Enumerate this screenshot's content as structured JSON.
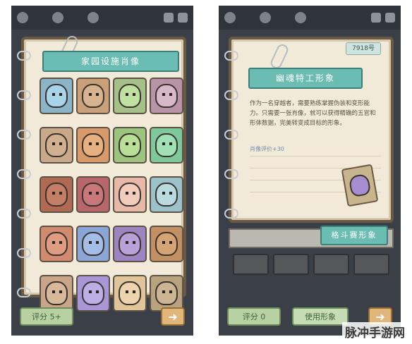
{
  "left": {
    "banner_title": "家园设施肖像",
    "button_label": "评分 5+",
    "arrow_label": "➜",
    "portraits": [
      {
        "color": "#8cb4c9",
        "face": "#a9d3e6"
      },
      {
        "color": "#c9a07a",
        "face": "#d7b48f"
      },
      {
        "color": "#a6c08a",
        "face": "#bfe0a0"
      },
      {
        "color": "#b993a8",
        "face": "#d6b8c8"
      },
      {
        "color": "#c9a98a",
        "face": "#d1b090"
      },
      {
        "color": "#d89a6a",
        "face": "#e6b080"
      },
      {
        "color": "#9bc57e",
        "face": "#b8de98"
      },
      {
        "color": "#7ec99b",
        "face": "#9fe0b4"
      },
      {
        "color": "#b06a54",
        "face": "#c47e66"
      },
      {
        "color": "#b8666a",
        "face": "#c8787a"
      },
      {
        "color": "#e7b8a8",
        "face": "#f2cbbd"
      },
      {
        "color": "#9bc2c8",
        "face": "#b9dadf"
      },
      {
        "color": "#d08a6e",
        "face": "#de9c82"
      },
      {
        "color": "#8aa6d6",
        "face": "#a4bde6"
      },
      {
        "color": "#9b86c2",
        "face": "#b6a2d8"
      },
      {
        "color": "#c29062",
        "face": "#d4a474"
      },
      {
        "color": "#c9a68a",
        "face": "#d8b89a"
      },
      {
        "color": "#a896d6",
        "face": "#bdaee6"
      },
      {
        "color": "#e0c49a",
        "face": "#eed4ae"
      },
      {
        "color": "#b9a27e",
        "face": "#cbb592"
      }
    ]
  },
  "right": {
    "tab_label": "7918号",
    "banner_title": "幽魂特工形象",
    "description": "作为一名穿越者，需要熟练掌握伪装和变形能力。只需要一张肖像，就可以获得精确的五官和形体数据，完美转变成目标的形象。",
    "rating": "肖像评价+30",
    "style_banner": "格斗赛形象",
    "btn_score": "评分 0",
    "btn_use": "使用形象",
    "arrow_label": "➜"
  },
  "watermark": "脉冲手游网"
}
